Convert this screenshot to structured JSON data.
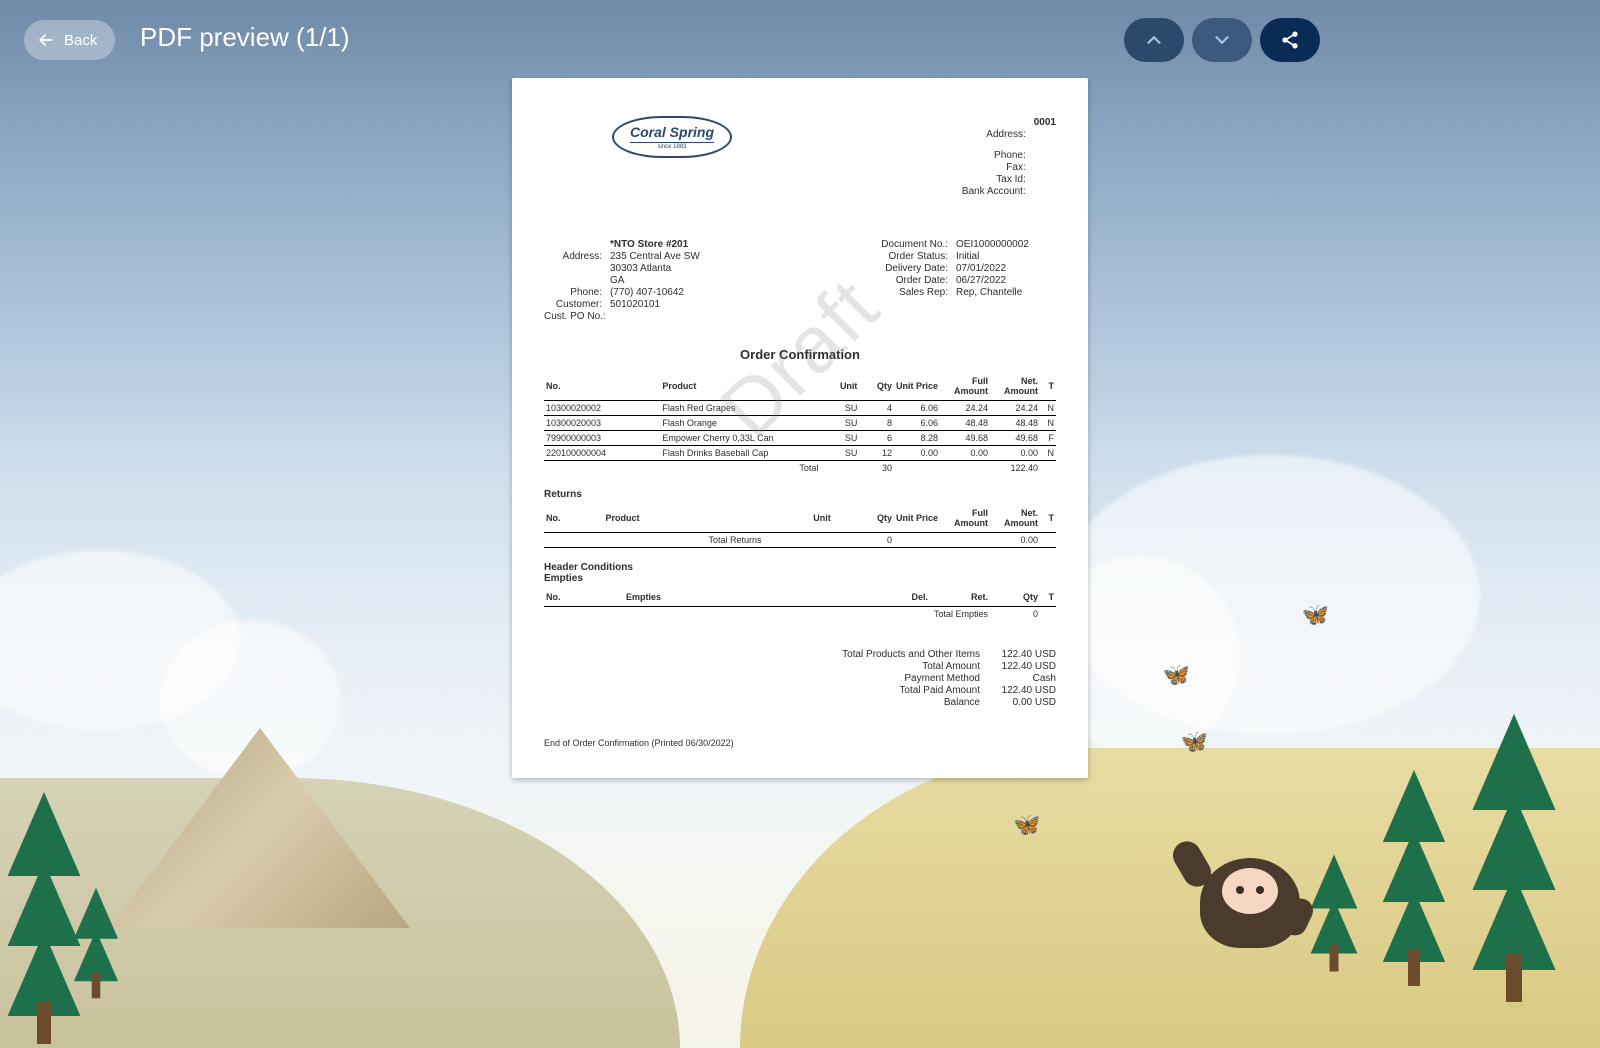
{
  "header": {
    "back_label": "Back",
    "title": "PDF preview (1/1)"
  },
  "document": {
    "watermark": "Draft",
    "logo": {
      "name": "Coral Spring",
      "tag": "since 1883"
    },
    "company": {
      "code": "0001",
      "labels": {
        "address": "Address:",
        "phone": "Phone:",
        "fax": "Fax:",
        "tax": "Tax Id:",
        "bank": "Bank Account:"
      }
    },
    "customer": {
      "name": "*NTO Store #201",
      "labels": {
        "address": "Address:",
        "phone": "Phone:",
        "customer": "Customer:",
        "po": "Cust. PO No.:"
      },
      "address_line1": "235 Central Ave SW",
      "address_line2": "30303 Atlanta",
      "address_line3": "GA",
      "phone": "(770) 407-10642",
      "customer_no": "501020101",
      "po": ""
    },
    "order": {
      "labels": {
        "doc": "Document No.:",
        "status": "Order Status:",
        "delivery": "Delivery Date:",
        "order_date": "Order Date:",
        "rep": "Sales Rep:"
      },
      "doc_no": "OEI1000000002",
      "status": "Initial",
      "delivery_date": "07/01/2022",
      "order_date": "06/27/2022",
      "rep": "Rep, Chantelle"
    },
    "title": "Order Confirmation",
    "columns": {
      "no": "No.",
      "product": "Product",
      "unit": "Unit",
      "qty": "Qty",
      "uprice": "Unit Price",
      "full": "Full Amount",
      "net": "Net. Amount",
      "t": "T"
    },
    "items": [
      {
        "no": "10300020002",
        "product": "Flash Red Grapes",
        "unit": "SU",
        "qty": "4",
        "uprice": "6.06",
        "full": "24.24",
        "net": "24.24",
        "t": "N"
      },
      {
        "no": "10300020003",
        "product": "Flash Orange",
        "unit": "SU",
        "qty": "8",
        "uprice": "6.06",
        "full": "48.48",
        "net": "48.48",
        "t": "N"
      },
      {
        "no": "79900000003",
        "product": "Empower Cherry 0,33L Can",
        "unit": "SU",
        "qty": "6",
        "uprice": "8.28",
        "full": "49.68",
        "net": "49.68",
        "t": "F"
      },
      {
        "no": "220100000004",
        "product": "Flash Drinks Baseball Cap",
        "unit": "SU",
        "qty": "12",
        "uprice": "0.00",
        "full": "0.00",
        "net": "0.00",
        "t": "N"
      }
    ],
    "items_total": {
      "label": "Total",
      "qty": "30",
      "net": "122.40"
    },
    "returns": {
      "label": "Returns",
      "total_label": "Total Returns",
      "qty": "0",
      "net": "0.00"
    },
    "conditions": {
      "header_label": "Header Conditions",
      "empties_label": "Empties",
      "cols": {
        "no": "No.",
        "empties": "Empties",
        "del": "Del.",
        "ret": "Ret.",
        "qty": "Qty",
        "t": "T"
      },
      "total_label": "Total Empties",
      "total_qty": "0"
    },
    "summary": {
      "rows": [
        {
          "k": "Total Products and Other Items",
          "v": "122.40 USD"
        },
        {
          "k": "Total Amount",
          "v": "122.40 USD"
        },
        {
          "k": "Payment Method",
          "v": "Cash"
        },
        {
          "k": "Total Paid Amount",
          "v": "122.40 USD"
        },
        {
          "k": "Balance",
          "v": "0.00 USD"
        }
      ]
    },
    "footer": "End of Order Confirmation (Printed 06/30/2022)"
  }
}
